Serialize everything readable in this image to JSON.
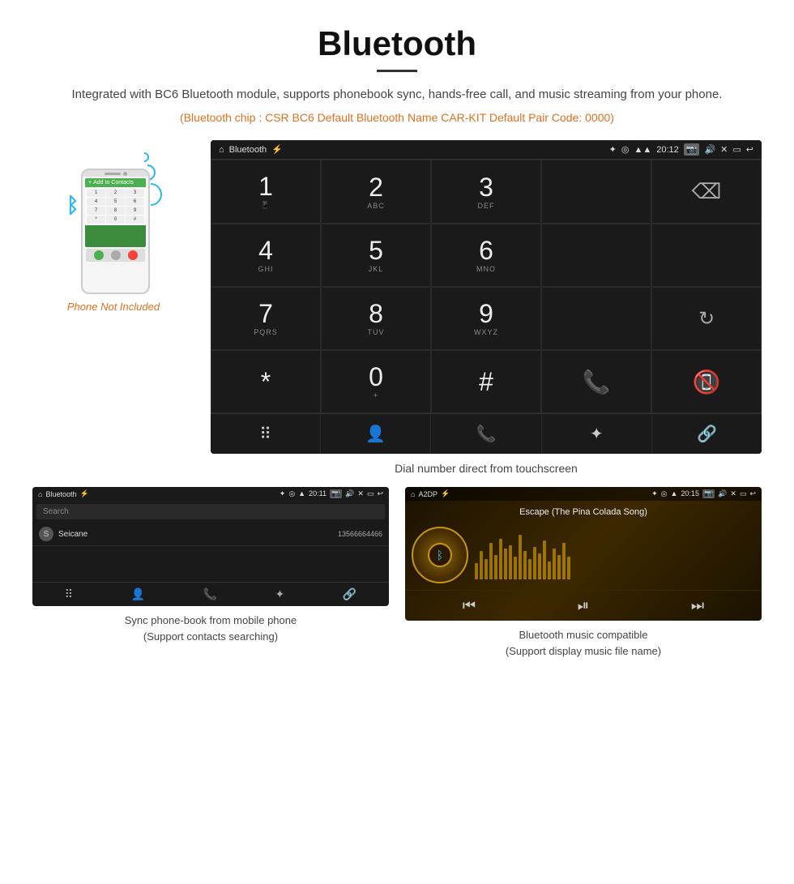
{
  "header": {
    "title": "Bluetooth",
    "description": "Integrated with BC6 Bluetooth module, supports phonebook sync, hands-free call, and music streaming from your phone.",
    "specs": "(Bluetooth chip : CSR BC6    Default Bluetooth Name CAR-KIT    Default Pair Code: 0000)"
  },
  "phone_label": "Phone Not Included",
  "main_screen": {
    "status_bar": {
      "home": "⌂",
      "title": "Bluetooth",
      "usb": "⚡",
      "bt": "✦",
      "location": "◎",
      "signal": "▲",
      "time": "20:12",
      "camera": "📷",
      "volume": "🔊",
      "close": "✕",
      "screen": "▭",
      "back": "↩"
    },
    "dialpad": [
      {
        "main": "1",
        "sub": ""
      },
      {
        "main": "2",
        "sub": "ABC"
      },
      {
        "main": "3",
        "sub": "DEF"
      },
      {
        "main": "",
        "sub": ""
      },
      {
        "main": "⌫",
        "sub": ""
      },
      {
        "main": "4",
        "sub": "GHI"
      },
      {
        "main": "5",
        "sub": "JKL"
      },
      {
        "main": "6",
        "sub": "MNO"
      },
      {
        "main": "",
        "sub": ""
      },
      {
        "main": "",
        "sub": ""
      },
      {
        "main": "7",
        "sub": "PQRS"
      },
      {
        "main": "8",
        "sub": "TUV"
      },
      {
        "main": "9",
        "sub": "WXYZ"
      },
      {
        "main": "",
        "sub": ""
      },
      {
        "main": "↻",
        "sub": ""
      },
      {
        "main": "*",
        "sub": ""
      },
      {
        "main": "0",
        "sub": "+"
      },
      {
        "main": "#",
        "sub": ""
      },
      {
        "main": "📞",
        "sub": ""
      },
      {
        "main": "📵",
        "sub": ""
      }
    ],
    "bottom_nav": [
      "⠿",
      "👤",
      "📞",
      "✦",
      "🔗"
    ]
  },
  "dial_caption": "Dial number direct from touchscreen",
  "phonebook_screen": {
    "status_title": "Bluetooth",
    "time": "20:11",
    "search_placeholder": "Search",
    "contacts": [
      {
        "initial": "S",
        "name": "Seicane",
        "number": "13566664466"
      }
    ],
    "nav_icons": [
      "⠿",
      "👤",
      "📞",
      "✦",
      "🔗"
    ]
  },
  "music_screen": {
    "status_title": "A2DP",
    "time": "20:15",
    "song_title": "Escape (The Pina Colada Song)",
    "viz_heights": [
      20,
      35,
      25,
      45,
      30,
      50,
      38,
      42,
      28,
      55,
      35,
      25,
      40,
      32,
      48,
      22,
      38,
      30,
      45,
      28
    ],
    "controls": [
      "⏮",
      "⏯",
      "⏭"
    ]
  },
  "phonebook_caption": "Sync phone-book from mobile phone\n(Support contacts searching)",
  "music_caption": "Bluetooth music compatible\n(Support display music file name)"
}
